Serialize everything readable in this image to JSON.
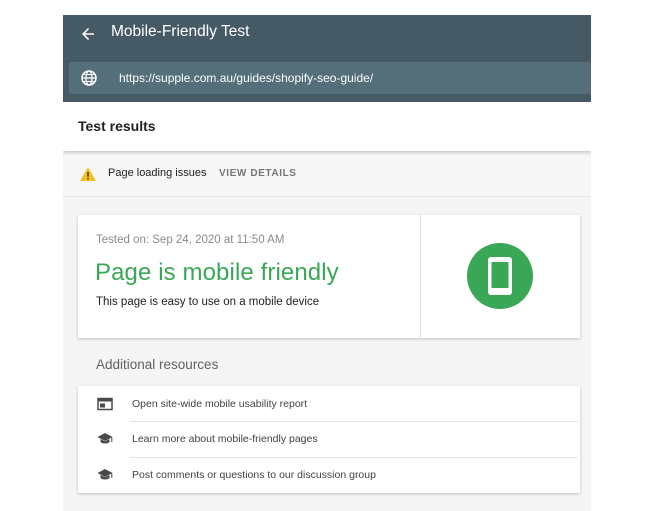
{
  "header": {
    "title": "Mobile-Friendly Test",
    "url": "https://supple.com.au/guides/shopify-seo-guide/"
  },
  "results": {
    "title": "Test results"
  },
  "issue": {
    "text": "Page loading issues",
    "action": "VIEW DETAILS",
    "icon": "warning-icon",
    "color": "#f2c12e"
  },
  "result": {
    "tested_on": "Tested on: Sep 24, 2020 at 11:50 AM",
    "verdict": "Page is mobile friendly",
    "description": "This page is easy to use on a mobile device",
    "icon": "smartphone-icon",
    "color": "#3aa757"
  },
  "resources": {
    "title": "Additional resources",
    "items": [
      {
        "label": "Open site-wide mobile usability report",
        "icon": "report-icon"
      },
      {
        "label": "Learn more about mobile-friendly pages",
        "icon": "school-icon"
      },
      {
        "label": "Post comments or questions to our discussion group",
        "icon": "school-icon"
      }
    ]
  }
}
